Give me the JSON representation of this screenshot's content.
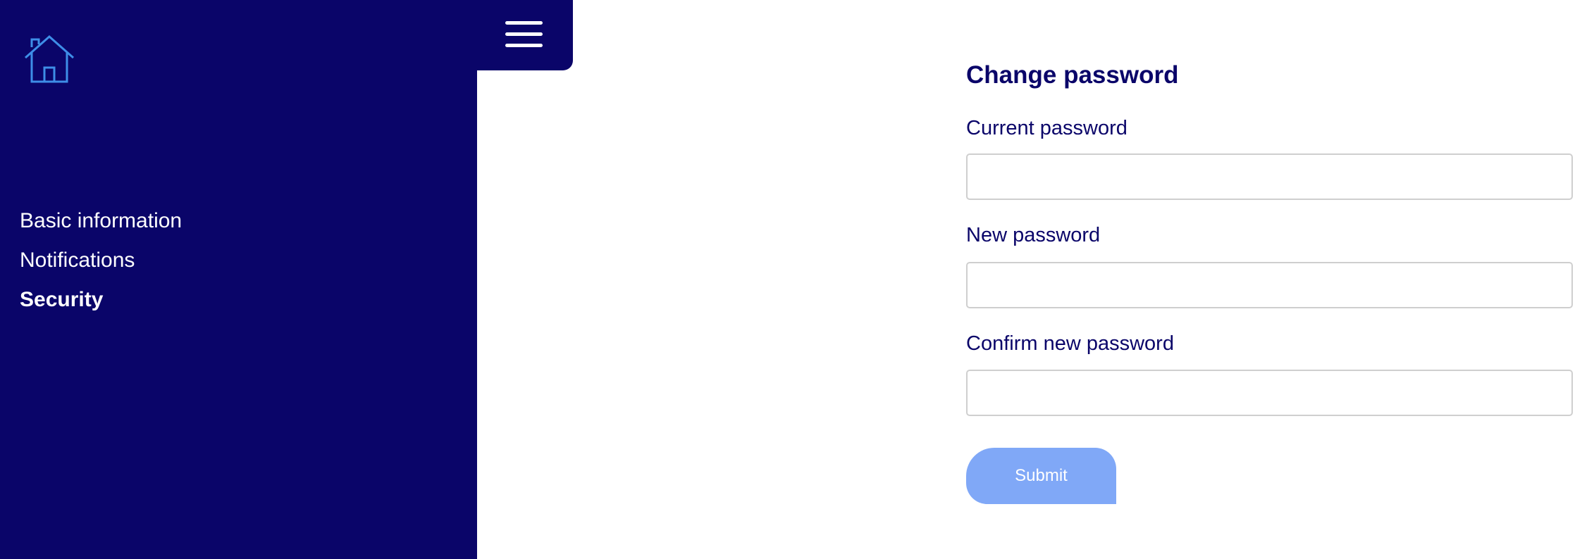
{
  "sidebar": {
    "home_icon": "home-icon",
    "menu_icon": "hamburger-menu-icon",
    "items": [
      {
        "label": "Basic information",
        "active": false
      },
      {
        "label": "Notifications",
        "active": false
      },
      {
        "label": "Security",
        "active": true
      }
    ]
  },
  "form": {
    "title": "Change password",
    "fields": [
      {
        "label": "Current password",
        "value": ""
      },
      {
        "label": "New password",
        "value": ""
      },
      {
        "label": "Confirm new password",
        "value": ""
      }
    ],
    "submit_label": "Submit"
  },
  "colors": {
    "sidebar_bg": "#0a0569",
    "heading_text": "#0a0569",
    "home_icon_stroke": "#3e8ee8",
    "submit_bg": "#80a8f7",
    "input_border": "#cfcfcf"
  }
}
